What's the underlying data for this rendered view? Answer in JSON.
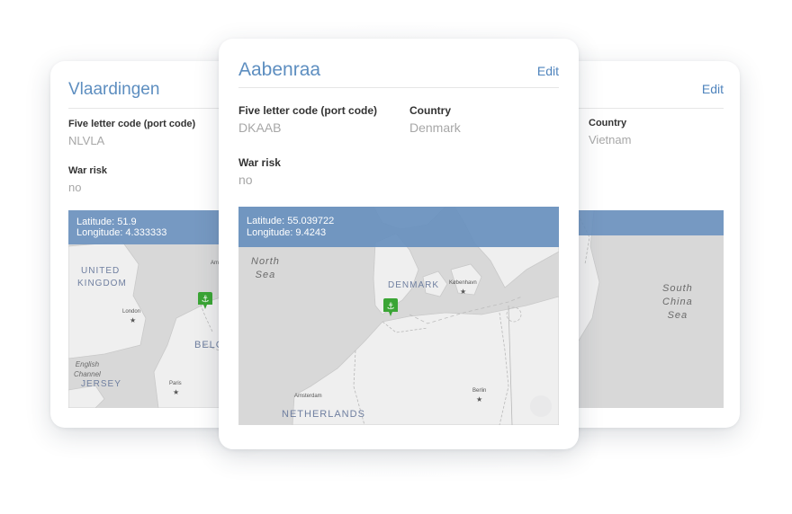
{
  "cards": {
    "left": {
      "title": "Vlaardingen",
      "port_code_label": "Five letter code (port code)",
      "port_code_value": "NLVLA",
      "war_risk_label": "War risk",
      "war_risk_value": "no",
      "latitude_text": "Latitude: 51.9",
      "longitude_text": "Longitude: 4.333333",
      "map_labels": {
        "uk": "UNITED",
        "uk2": "KINGDOM",
        "london": "London",
        "channel": "English",
        "channel2": "Channel",
        "jersey": "JERSEY",
        "paris": "Paris",
        "belg": "BELG",
        "ams": "Ams"
      }
    },
    "main": {
      "title": "Aabenraa",
      "edit_label": "Edit",
      "port_code_label": "Five letter code (port code)",
      "port_code_value": "DKAAB",
      "country_label": "Country",
      "country_value": "Denmark",
      "war_risk_label": "War risk",
      "war_risk_value": "no",
      "latitude_text": "Latitude: 55.039722",
      "longitude_text": "Longitude: 9.4243",
      "map_labels": {
        "north": "North",
        "sea": "Sea",
        "denmark": "DENMARK",
        "kobenhavn": "København",
        "amsterdam": "Amsterdam",
        "berlin": "Berlin",
        "netherlands": "NETHERLANDS"
      }
    },
    "right": {
      "edit_label": "Edit",
      "country_label": "Country",
      "country_value": "Vietnam",
      "map_labels": {
        "south": "South",
        "china": "China",
        "sea": "Sea"
      }
    }
  },
  "colors": {
    "title": "#5d8ec0",
    "edit": "#4f84bd",
    "coord_bar": "#6890be",
    "pin": "#3aa535"
  }
}
